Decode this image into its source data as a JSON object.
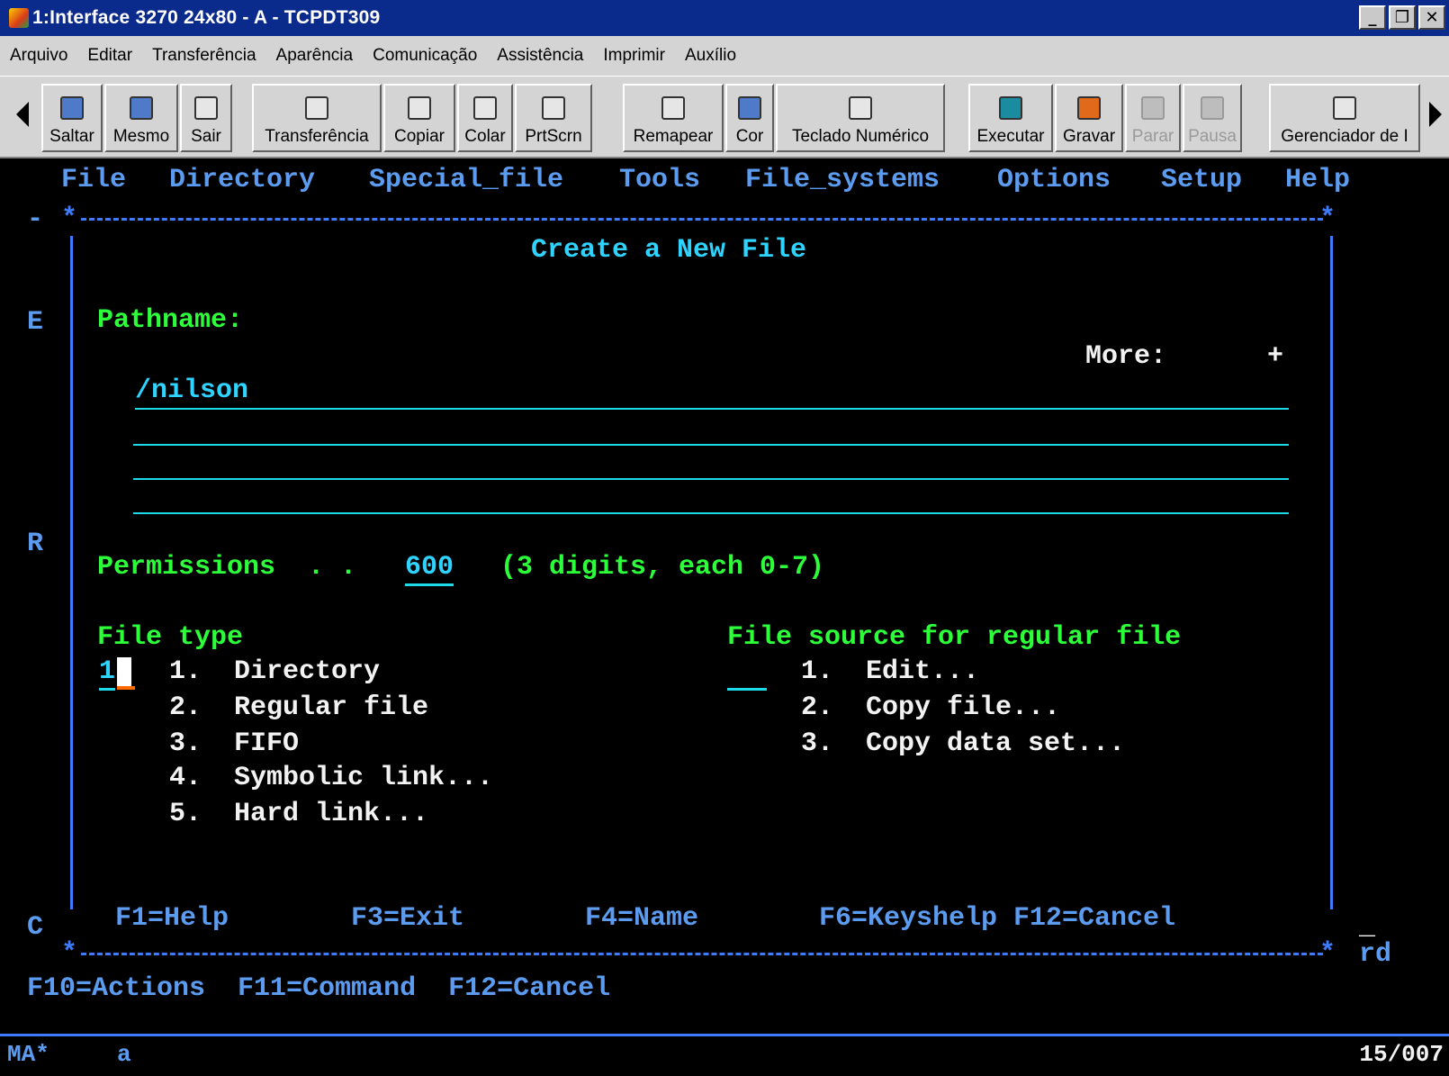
{
  "window": {
    "title": "1:Interface 3270 24x80 - A - TCPDT309",
    "buttons": [
      "_",
      "❐",
      "✕"
    ]
  },
  "menubar": [
    "Arquivo",
    "Editar",
    "Transferência",
    "Aparência",
    "Comunicação",
    "Assistência",
    "Imprimir",
    "Auxílio"
  ],
  "toolbar": {
    "buttons": [
      {
        "label": "Saltar",
        "icon": "jump-icon"
      },
      {
        "label": "Mesmo",
        "icon": "same-icon"
      },
      {
        "label": "Sair",
        "icon": "exit-icon"
      },
      {
        "label": "Transferência",
        "icon": "transfer-icon"
      },
      {
        "label": "Copiar",
        "icon": "copy-icon"
      },
      {
        "label": "Colar",
        "icon": "paste-icon"
      },
      {
        "label": "PrtScrn",
        "icon": "print-screen-icon"
      },
      {
        "label": "Remapear",
        "icon": "remap-icon"
      },
      {
        "label": "Cor",
        "icon": "color-icon"
      },
      {
        "label": "Teclado Numérico",
        "icon": "keypad-icon"
      },
      {
        "label": "Executar",
        "icon": "run-icon"
      },
      {
        "label": "Gravar",
        "icon": "record-icon"
      },
      {
        "label": "Parar",
        "icon": "stop-icon",
        "disabled": true
      },
      {
        "label": "Pausa",
        "icon": "pause-icon",
        "disabled": true
      },
      {
        "label": "Gerenciador de I",
        "icon": "manager-icon"
      }
    ]
  },
  "terminal": {
    "menu": [
      "File",
      "Directory",
      "Special_file",
      "Tools",
      "File_systems",
      "Options",
      "Setup",
      "Help"
    ],
    "dialog_title": "Create a New File",
    "pathname_label": "Pathname:",
    "more_label": "More:",
    "more_indicator": "+",
    "pathname_value": "/nilson",
    "permissions_label": "Permissions  . .",
    "permissions_value": "600",
    "permissions_hint": "(3 digits, each 0-7)",
    "file_type_label": "File type",
    "file_type_value": "1",
    "file_types": [
      "1.  Directory",
      "2.  Regular file",
      "3.  FIFO",
      "4.  Symbolic link...",
      "5.  Hard link..."
    ],
    "file_source_label": "File source for regular file",
    "file_source_value": "",
    "file_sources": [
      "1.  Edit...",
      "2.  Copy file...",
      "3.  Copy data set..."
    ],
    "dialog_fkeys": [
      "F1=Help",
      "F3=Exit",
      "F4=Name",
      "F6=Keyshelp F12=Cancel"
    ],
    "left_letters": [
      "-",
      "E",
      "R",
      "C"
    ],
    "right_fragments": [
      "_",
      "rd"
    ],
    "bottom_fkeys": "F10=Actions  F11=Command  F12=Cancel"
  },
  "statusbar": {
    "left": "MA*",
    "mode": "a",
    "position": "15/007"
  }
}
